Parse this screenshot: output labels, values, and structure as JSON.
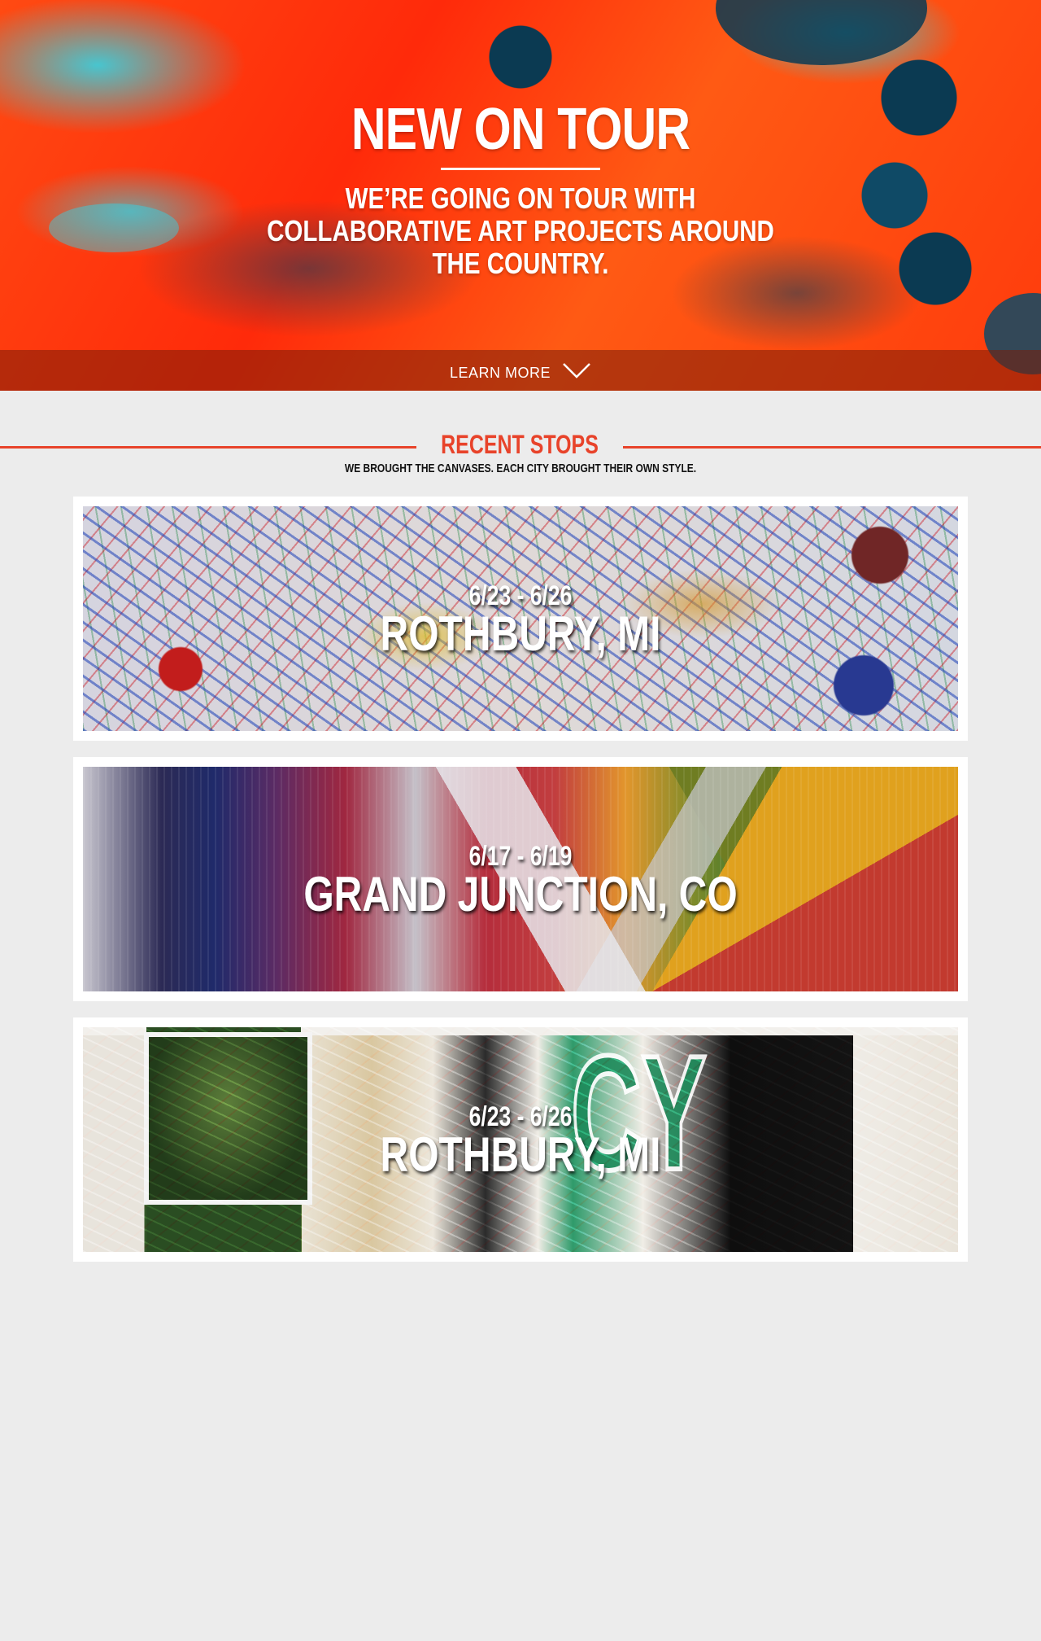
{
  "hero": {
    "title": "NEW ON TOUR",
    "subtitle": "WE’RE GOING ON TOUR WITH COLLABORATIVE ART PROJECTS AROUND THE COUNTRY.",
    "learn_more": "LEARN MORE",
    "learn_more_icon": "chevron-down-icon"
  },
  "recent": {
    "title": "RECENT STOPS",
    "subtitle": "WE BROUGHT THE CANVASES. EACH CITY BROUGHT THEIR OWN STYLE.",
    "accent_color": "#e8432a"
  },
  "stops": [
    {
      "dates": "6/23 - 6/26",
      "city": "ROTHBURY, MI"
    },
    {
      "dates": "6/17 - 6/19",
      "city": "GRAND JUNCTION, CO"
    },
    {
      "dates": "6/23 - 6/26",
      "city": "ROTHBURY, MI"
    }
  ]
}
